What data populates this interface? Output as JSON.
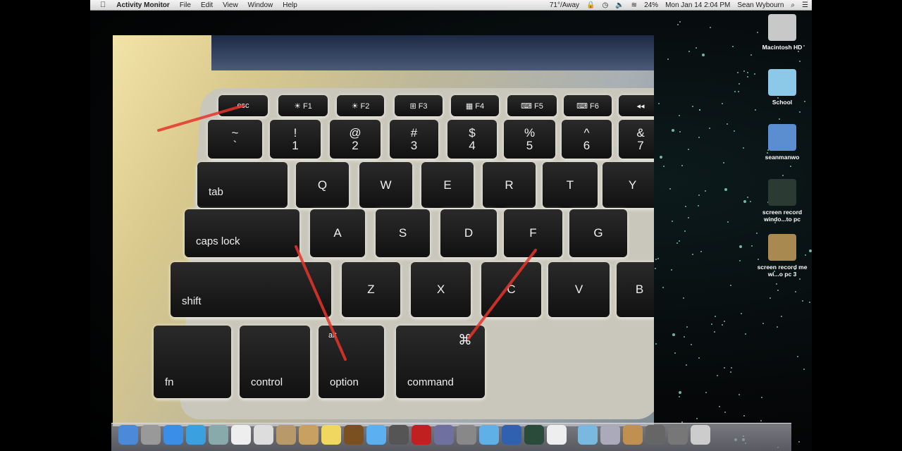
{
  "menubar": {
    "apple": "",
    "app": "Activity Monitor",
    "menus": [
      "File",
      "Edit",
      "View",
      "Window",
      "Help"
    ],
    "status": [
      "71°/Away",
      "24%",
      "Mon Jan 14  2:04 PM",
      "Sean Wybourn"
    ]
  },
  "keyboard": {
    "fn_row": [
      "esc",
      "☀ F1",
      "☀ F2",
      "⊞ F3",
      "▦ F4",
      "⌨ F5",
      "⌨ F6",
      "◂◂"
    ],
    "number_row": [
      "~ `",
      "! 1",
      "@ 2",
      "# 3",
      "$ 4",
      "% 5",
      "^ 6",
      "& 7"
    ],
    "qwerty_row": [
      "tab",
      "Q",
      "W",
      "E",
      "R",
      "T",
      "Y"
    ],
    "home_row": [
      "caps lock",
      "A",
      "S",
      "D",
      "F",
      "G"
    ],
    "shift_row": [
      "shift",
      "Z",
      "X",
      "C",
      "V",
      "B"
    ],
    "bottom_row": [
      "fn",
      "control",
      "option",
      "command"
    ],
    "command_symbol": "⌘",
    "option_symbol": "alt",
    "annotation_color": "#e8342a"
  },
  "desktop_icons": [
    {
      "label": "Macintosh HD",
      "icon": "hard-drive-icon"
    },
    {
      "label": "School",
      "icon": "folder-icon"
    },
    {
      "label": "seanmanwo",
      "icon": "network-share-icon"
    },
    {
      "label": "screen record windo...to pc",
      "icon": "video-thumbnail-icon"
    },
    {
      "label": "screen record me wi...o pc 3",
      "icon": "video-thumbnail-icon"
    }
  ],
  "dock": [
    "finder",
    "launchpad",
    "app-store",
    "safari",
    "preview",
    "calendar",
    "textedit",
    "contacts",
    "itunes-folder",
    "stickies",
    "world-of-warcraft",
    "messages",
    "facetime",
    "photo-booth",
    "iphoto",
    "system-preferences",
    "itunes",
    "quicktime",
    "activity-monitor",
    "documents",
    "downloads",
    "applications",
    "pc-window",
    "app",
    "app",
    "trash"
  ]
}
